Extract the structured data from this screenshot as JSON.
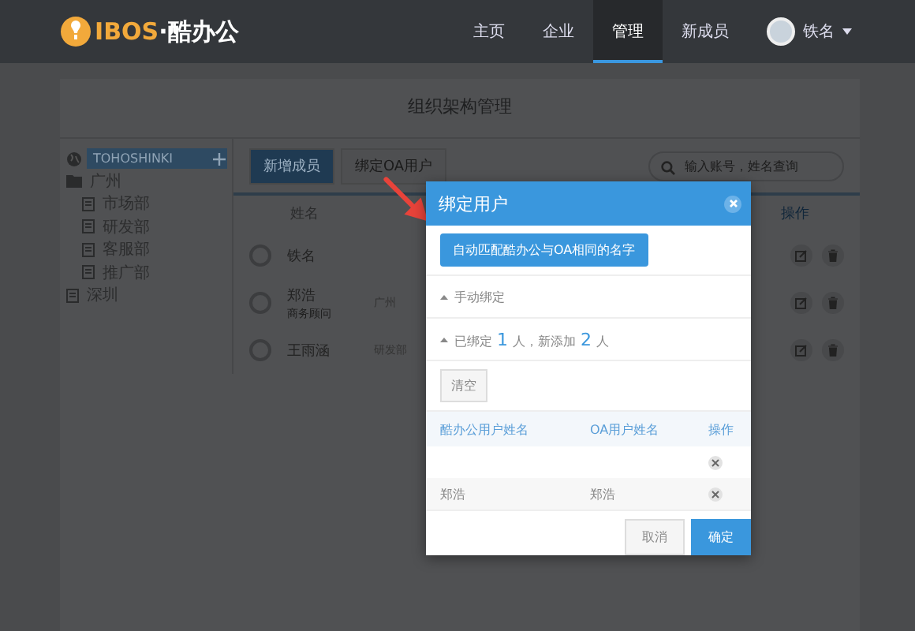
{
  "nav": {
    "logo": {
      "brand": "IBOS",
      "suffix": "·酷办公"
    },
    "items": [
      {
        "label": "主页",
        "selected": false
      },
      {
        "label": "企业",
        "selected": false
      },
      {
        "label": "管理",
        "selected": true
      },
      {
        "label": "新成员",
        "selected": false
      }
    ],
    "user": {
      "name": "铁名"
    }
  },
  "page": {
    "title": "组织架构管理"
  },
  "tree": {
    "root": "TOHOSHINKI",
    "items": [
      {
        "label": "广州",
        "expanded": true,
        "children": [
          {
            "label": "市场部"
          },
          {
            "label": "研发部"
          },
          {
            "label": "客服部"
          },
          {
            "label": "推广部"
          }
        ]
      },
      {
        "label": "深圳",
        "expanded": false
      }
    ]
  },
  "toolbar": {
    "buttons": [
      "新增成员",
      "绑定OA用户"
    ],
    "search": {
      "placeholder": "输入账号，姓名查询"
    }
  },
  "table": {
    "columns": [
      "姓名",
      "操作"
    ],
    "rows": [
      {
        "name": "铁名"
      },
      {
        "name": "郑浩",
        "title": "商务顾问",
        "dept": "广州"
      },
      {
        "name": "王雨涵",
        "dept": "研发部"
      }
    ]
  },
  "modal": {
    "title": "绑定用户",
    "auto_button": "自动匹配酷办公与OA相同的名字",
    "manual": "手动绑定",
    "summary": [
      {
        "kind": "text",
        "text": "已绑定"
      },
      {
        "kind": "count",
        "text": "1"
      },
      {
        "kind": "text",
        "text": "人，"
      },
      {
        "kind": "text",
        "text": "新添加"
      },
      {
        "kind": "count",
        "text": "2"
      },
      {
        "kind": "text",
        "text": "人"
      }
    ],
    "clear_button": "清空",
    "columns": [
      "酷办公用户姓名",
      "OA用户姓名",
      "操作"
    ],
    "rows": [
      {},
      {
        "ibos_name": "郑浩",
        "oa_name": "郑浩"
      }
    ],
    "buttons": [
      "取消",
      "确定"
    ]
  }
}
